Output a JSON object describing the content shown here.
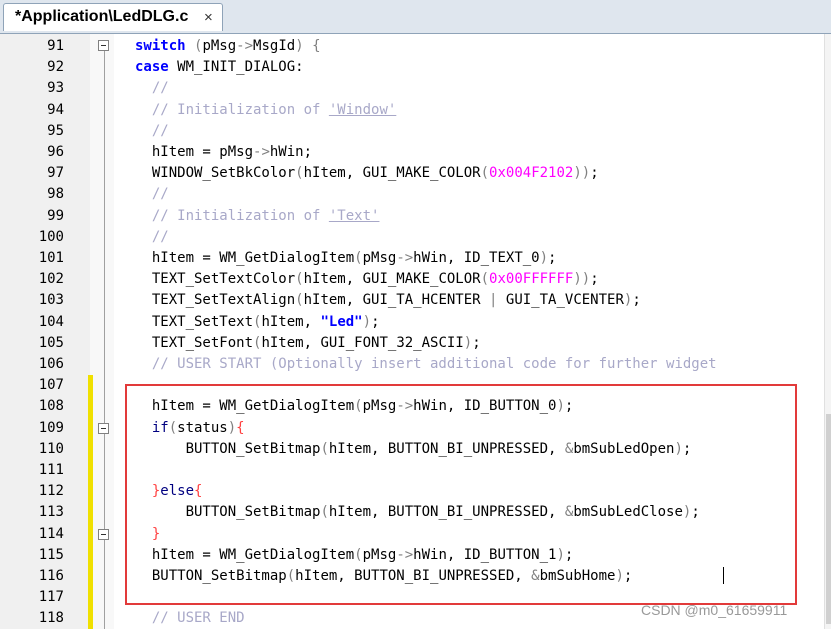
{
  "tab": {
    "title": "*Application\\LedDLG.c",
    "close_glyph": "×"
  },
  "watermark": "CSDN @m0_61659911",
  "lines": [
    {
      "num": "91",
      "tokens": [
        [
          "k",
          "switch"
        ],
        [
          "t",
          " "
        ],
        [
          "o",
          "("
        ],
        [
          "t",
          "pMsg"
        ],
        [
          "o",
          "->"
        ],
        [
          "t",
          "MsgId"
        ],
        [
          "o",
          ")"
        ],
        [
          "t",
          " "
        ],
        [
          "o",
          "{"
        ]
      ]
    },
    {
      "num": "92",
      "tokens": [
        [
          "k",
          "case"
        ],
        [
          "t",
          " WM_INIT_DIALOG:"
        ]
      ]
    },
    {
      "num": "93",
      "tokens": [
        [
          "c",
          "  //"
        ]
      ]
    },
    {
      "num": "94",
      "tokens": [
        [
          "c",
          "  // Initialization of "
        ],
        [
          "cs",
          "'Window'"
        ]
      ]
    },
    {
      "num": "95",
      "tokens": [
        [
          "c",
          "  //"
        ]
      ]
    },
    {
      "num": "96",
      "tokens": [
        [
          "t",
          "  hItem = pMsg"
        ],
        [
          "o",
          "->"
        ],
        [
          "t",
          "hWin;"
        ]
      ]
    },
    {
      "num": "97",
      "tokens": [
        [
          "t",
          "  WINDOW_SetBkColor"
        ],
        [
          "o",
          "("
        ],
        [
          "t",
          "hItem, GUI_MAKE_COLOR"
        ],
        [
          "o",
          "("
        ],
        [
          "n",
          "0x004F2102"
        ],
        [
          "o",
          "))"
        ],
        [
          "t",
          ";"
        ]
      ]
    },
    {
      "num": "98",
      "tokens": [
        [
          "c",
          "  //"
        ]
      ]
    },
    {
      "num": "99",
      "tokens": [
        [
          "c",
          "  // Initialization of "
        ],
        [
          "cs",
          "'Text'"
        ]
      ]
    },
    {
      "num": "100",
      "tokens": [
        [
          "c",
          "  //"
        ]
      ]
    },
    {
      "num": "101",
      "tokens": [
        [
          "t",
          "  hItem = WM_GetDialogItem"
        ],
        [
          "o",
          "("
        ],
        [
          "t",
          "pMsg"
        ],
        [
          "o",
          "->"
        ],
        [
          "t",
          "hWin, ID_TEXT_0"
        ],
        [
          "o",
          ")"
        ],
        [
          "t",
          ";"
        ]
      ]
    },
    {
      "num": "102",
      "tokens": [
        [
          "t",
          "  TEXT_SetTextColor"
        ],
        [
          "o",
          "("
        ],
        [
          "t",
          "hItem, GUI_MAKE_COLOR"
        ],
        [
          "o",
          "("
        ],
        [
          "n",
          "0x00FFFFFF"
        ],
        [
          "o",
          "))"
        ],
        [
          "t",
          ";"
        ]
      ]
    },
    {
      "num": "103",
      "tokens": [
        [
          "t",
          "  TEXT_SetTextAlign"
        ],
        [
          "o",
          "("
        ],
        [
          "t",
          "hItem, GUI_TA_HCENTER "
        ],
        [
          "o",
          "|"
        ],
        [
          "t",
          " GUI_TA_VCENTER"
        ],
        [
          "o",
          ")"
        ],
        [
          "t",
          ";"
        ]
      ]
    },
    {
      "num": "104",
      "tokens": [
        [
          "t",
          "  TEXT_SetText"
        ],
        [
          "o",
          "("
        ],
        [
          "t",
          "hItem, "
        ],
        [
          "s",
          "\"Led\""
        ],
        [
          "o",
          ")"
        ],
        [
          "t",
          ";"
        ]
      ]
    },
    {
      "num": "105",
      "tokens": [
        [
          "t",
          "  TEXT_SetFont"
        ],
        [
          "o",
          "("
        ],
        [
          "t",
          "hItem, GUI_FONT_32_ASCII"
        ],
        [
          "o",
          ")"
        ],
        [
          "t",
          ";"
        ]
      ]
    },
    {
      "num": "106",
      "tokens": [
        [
          "c",
          "  // USER START (Optionally insert additional code for further widget"
        ]
      ]
    },
    {
      "num": "107",
      "tokens": []
    },
    {
      "num": "108",
      "tokens": [
        [
          "t",
          "  hItem = WM_GetDialogItem"
        ],
        [
          "o",
          "("
        ],
        [
          "t",
          "pMsg"
        ],
        [
          "o",
          "->"
        ],
        [
          "t",
          "hWin, ID_BUTTON_0"
        ],
        [
          "o",
          ")"
        ],
        [
          "t",
          ";"
        ]
      ]
    },
    {
      "num": "109",
      "tokens": [
        [
          "t",
          "  "
        ],
        [
          "kn",
          "if"
        ],
        [
          "o",
          "("
        ],
        [
          "t",
          "status"
        ],
        [
          "o",
          ")"
        ],
        [
          "br",
          "{"
        ]
      ]
    },
    {
      "num": "110",
      "tokens": [
        [
          "t",
          "      BUTTON_SetBitmap"
        ],
        [
          "o",
          "("
        ],
        [
          "t",
          "hItem, BUTTON_BI_UNPRESSED, "
        ],
        [
          "o",
          "&"
        ],
        [
          "t",
          "bmSubLedOpen"
        ],
        [
          "o",
          ")"
        ],
        [
          "t",
          ";"
        ]
      ]
    },
    {
      "num": "111",
      "tokens": []
    },
    {
      "num": "112",
      "tokens": [
        [
          "t",
          "  "
        ],
        [
          "br",
          "}"
        ],
        [
          "kn",
          "else"
        ],
        [
          "br",
          "{"
        ]
      ]
    },
    {
      "num": "113",
      "tokens": [
        [
          "t",
          "      BUTTON_SetBitmap"
        ],
        [
          "o",
          "("
        ],
        [
          "t",
          "hItem, BUTTON_BI_UNPRESSED, "
        ],
        [
          "o",
          "&"
        ],
        [
          "t",
          "bmSubLedClose"
        ],
        [
          "o",
          ")"
        ],
        [
          "t",
          ";"
        ]
      ]
    },
    {
      "num": "114",
      "tokens": [
        [
          "t",
          "  "
        ],
        [
          "br",
          "}"
        ]
      ]
    },
    {
      "num": "115",
      "tokens": [
        [
          "t",
          "  hItem = WM_GetDialogItem"
        ],
        [
          "o",
          "("
        ],
        [
          "t",
          "pMsg"
        ],
        [
          "o",
          "->"
        ],
        [
          "t",
          "hWin, ID_BUTTON_1"
        ],
        [
          "o",
          ")"
        ],
        [
          "t",
          ";"
        ]
      ]
    },
    {
      "num": "116",
      "tokens": [
        [
          "t",
          "  BUTTON_SetBitmap"
        ],
        [
          "o",
          "("
        ],
        [
          "t",
          "hItem, BUTTON_BI_UNPRESSED, "
        ],
        [
          "o",
          "&"
        ],
        [
          "t",
          "bmSubHome"
        ],
        [
          "o",
          ")"
        ],
        [
          "t",
          ";"
        ]
      ]
    },
    {
      "num": "117",
      "tokens": []
    },
    {
      "num": "118",
      "tokens": [
        [
          "c",
          "  // USER END"
        ]
      ]
    }
  ]
}
